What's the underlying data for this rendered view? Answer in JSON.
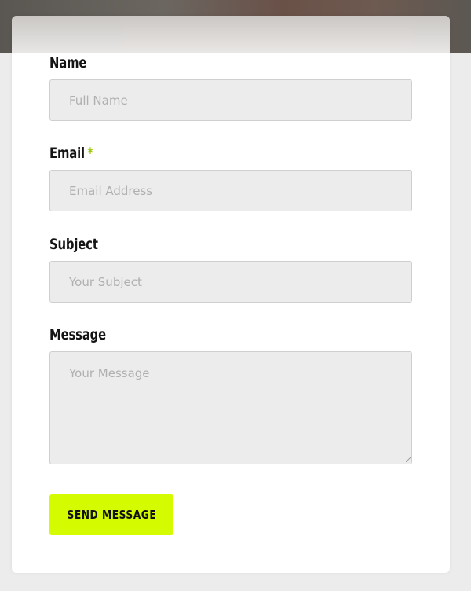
{
  "form": {
    "name": {
      "label": "Name",
      "placeholder": "Full Name",
      "value": ""
    },
    "email": {
      "label": "Email",
      "required_marker": "*",
      "placeholder": "Email Address",
      "value": ""
    },
    "subject": {
      "label": "Subject",
      "placeholder": "Your Subject",
      "value": ""
    },
    "message": {
      "label": "Message",
      "placeholder": "Your Message",
      "value": ""
    },
    "submit_label": "SEND MESSAGE"
  },
  "colors": {
    "accent": "#d4fb00",
    "required_marker": "#9bc80a",
    "input_bg": "#ececec",
    "input_border": "#cfcfcf",
    "placeholder_text": "#b0b0b0",
    "label_text": "#141414"
  }
}
